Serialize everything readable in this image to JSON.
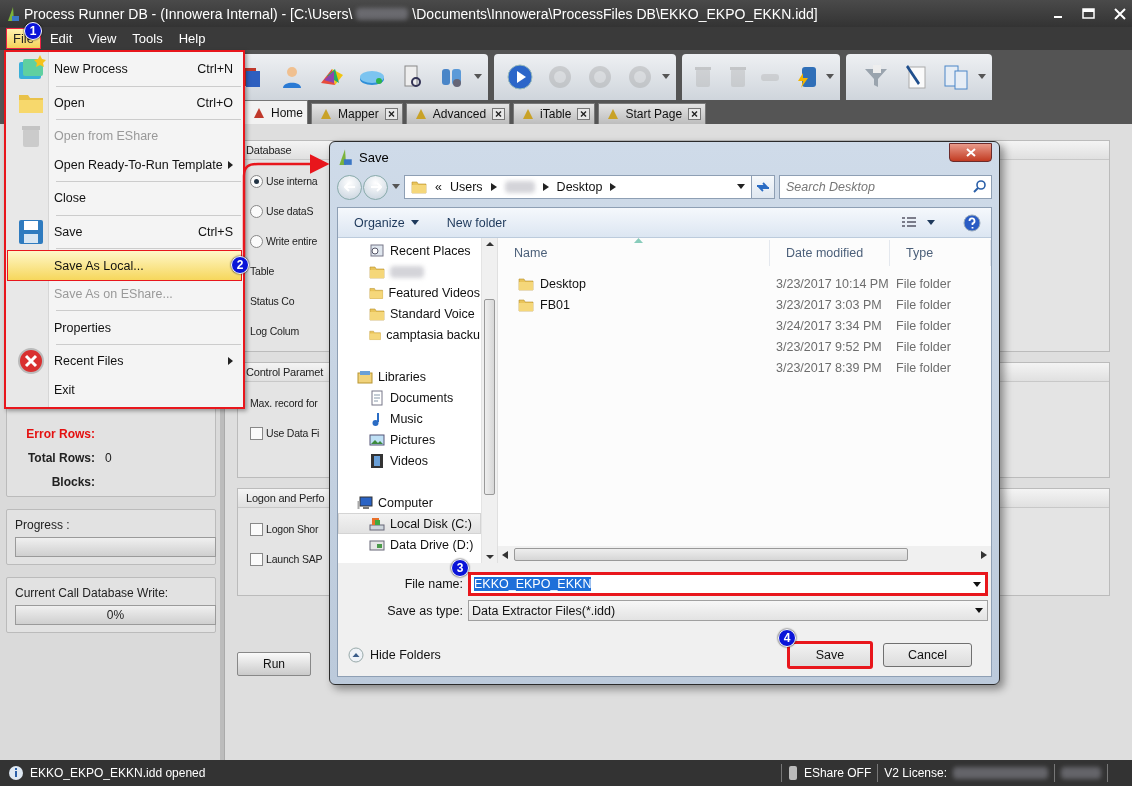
{
  "window": {
    "title_parts": [
      "Process Runner DB - (Innowera Internal) - [C:\\Users\\",
      "\\Documents\\Innowera\\ProcessFiles DB\\EKKO_EKPO_EKKN.idd]"
    ]
  },
  "menu_bar": [
    {
      "label": "File",
      "selected": true
    },
    {
      "label": "Edit",
      "selected": false
    },
    {
      "label": "View",
      "selected": false
    },
    {
      "label": "Tools",
      "selected": false
    },
    {
      "label": "Help",
      "selected": false
    }
  ],
  "toolbar": [
    {
      "items": [
        {
          "disabled": false
        },
        {
          "disabled": false
        },
        {
          "disabled": false
        },
        {
          "disabled": false
        },
        {
          "disabled": false
        },
        {
          "disabled": false
        }
      ]
    },
    {
      "items": [
        {
          "disabled": false
        },
        {
          "disabled": true
        },
        {
          "disabled": true
        },
        {
          "disabled": true
        }
      ]
    },
    {
      "items": [
        {
          "disabled": true
        },
        {
          "disabled": true
        },
        {
          "disabled": true
        },
        {
          "disabled": false
        }
      ]
    },
    {
      "items": [
        {
          "disabled": false
        },
        {
          "disabled": false
        },
        {
          "disabled": false
        }
      ]
    }
  ],
  "tabs": [
    {
      "label": "Home",
      "selected": true,
      "closable": false
    },
    {
      "label": "Mapper",
      "selected": false,
      "closable": true
    },
    {
      "label": "Advanced",
      "selected": false,
      "closable": true
    },
    {
      "label": "iTable",
      "selected": false,
      "closable": true
    },
    {
      "label": "Start Page",
      "selected": false,
      "closable": true
    }
  ],
  "left_panel": {
    "stats": [
      {
        "label": "Error Rows:",
        "error": true
      },
      {
        "label": "Total Rows:",
        "value": "0",
        "error": false
      },
      {
        "label": "Blocks:",
        "error": false
      }
    ],
    "progress": {
      "label": "Progress :",
      "level": 0
    },
    "current_write": {
      "label": "Current Call Database Write:",
      "level": 0,
      "reading": "0%"
    }
  },
  "groups": [
    {
      "title": "Database",
      "rows": [
        {
          "kind": "radio",
          "label": "Use interna",
          "selected": true
        },
        {
          "kind": "radio",
          "label": "Use dataS",
          "selected": false
        },
        {
          "kind": "radio",
          "label": "Write entire",
          "selected": false
        },
        {
          "kind": "label",
          "label": "Table"
        },
        {
          "kind": "label",
          "label": "Status Co"
        },
        {
          "kind": "label",
          "label": "Log Colum"
        }
      ]
    },
    {
      "title": "Control Paramet",
      "rows": [
        {
          "kind": "label",
          "label": "Max. record for"
        },
        {
          "kind": "checkbox",
          "label": "Use Data Fi",
          "checked": false
        }
      ]
    },
    {
      "title": "Logon and Perfo",
      "rows": [
        {
          "kind": "checkbox",
          "label": "Logon Shor",
          "checked": false
        },
        {
          "kind": "checkbox",
          "label": "Launch SAP",
          "checked": false
        }
      ]
    }
  ],
  "run_button": "Run",
  "file_menu": {
    "annotated": true,
    "items": [
      {
        "kind": "item",
        "label": "New Process",
        "shortcut": "Ctrl+N",
        "selected": false,
        "disabled": false,
        "submenu": false
      },
      {
        "kind": "separator"
      },
      {
        "kind": "item",
        "label": "Open",
        "shortcut": "Ctrl+O",
        "selected": false,
        "disabled": false,
        "submenu": false
      },
      {
        "kind": "separator"
      },
      {
        "kind": "item",
        "label": "Open from EShare",
        "selected": false,
        "disabled": true,
        "submenu": false
      },
      {
        "kind": "item",
        "label": "Open Ready-To-Run Template",
        "selected": false,
        "disabled": false,
        "submenu": true
      },
      {
        "kind": "separator"
      },
      {
        "kind": "item",
        "label": "Close",
        "selected": false,
        "disabled": false,
        "submenu": false
      },
      {
        "kind": "separator"
      },
      {
        "kind": "item",
        "label": "Save",
        "shortcut": "Ctrl+S",
        "selected": false,
        "disabled": false,
        "submenu": false
      },
      {
        "kind": "separator"
      },
      {
        "kind": "item",
        "label": "Save As Local...",
        "selected": true,
        "disabled": false,
        "submenu": false
      },
      {
        "kind": "item",
        "label": "Save As on EShare...",
        "selected": false,
        "disabled": true,
        "submenu": false
      },
      {
        "kind": "separator"
      },
      {
        "kind": "item",
        "label": "Properties",
        "selected": false,
        "disabled": false,
        "submenu": false
      },
      {
        "kind": "separator"
      },
      {
        "kind": "item",
        "label": "Recent Files",
        "selected": false,
        "disabled": false,
        "submenu": true
      },
      {
        "kind": "item",
        "label": "Exit",
        "selected": false,
        "disabled": false,
        "submenu": false
      }
    ]
  },
  "save_dialog": {
    "title": "Save",
    "address": {
      "prefix": "«",
      "crumbs": [
        "Users",
        "Desktop"
      ]
    },
    "search": {
      "placeholder": "Search Desktop"
    },
    "commands": [
      "Organize",
      "New folder"
    ],
    "nav": [
      {
        "label": "Recent Places",
        "kind": "recent",
        "selected": false
      },
      {
        "kind": "folder",
        "selected": false,
        "redacted": true
      },
      {
        "label": "Featured Videos",
        "kind": "folder",
        "selected": false
      },
      {
        "label": "Standard Voice",
        "kind": "folder",
        "selected": false
      },
      {
        "label": "camptasia backu",
        "kind": "folder",
        "selected": false
      },
      {
        "label": "Libraries",
        "kind": "libraries",
        "selected": false,
        "children": [
          {
            "label": "Documents",
            "kind": "documents",
            "selected": false
          },
          {
            "label": "Music",
            "kind": "music",
            "selected": false
          },
          {
            "label": "Pictures",
            "kind": "pictures",
            "selected": false
          },
          {
            "label": "Videos",
            "kind": "videos",
            "selected": false
          }
        ]
      },
      {
        "label": "Computer",
        "kind": "computer",
        "selected": false,
        "children": [
          {
            "label": "Local Disk (C:)",
            "kind": "disk",
            "selected": true
          },
          {
            "label": "Data Drive (D:)",
            "kind": "drive",
            "selected": false
          }
        ]
      }
    ],
    "columns": [
      "Name",
      "Date modified",
      "Type"
    ],
    "rows": [
      {
        "name": "Desktop",
        "date": "3/23/2017 10:14 PM",
        "type": "File folder"
      },
      {
        "name": "FB01",
        "date": "3/23/2017 3:03 PM",
        "type": "File folder"
      },
      {
        "date": "3/24/2017 3:34 PM",
        "type": "File folder"
      },
      {
        "date": "3/23/2017 9:52 PM",
        "type": "File folder"
      },
      {
        "date": "3/23/2017 8:39 PM",
        "type": "File folder"
      }
    ],
    "file_name": {
      "label": "File name:",
      "value": "EKKO_EKPO_EKKN",
      "annotated": true
    },
    "file_type": {
      "label": "Save as type:",
      "value": "Data Extractor Files(*.idd)"
    },
    "hide_folders": "Hide Folders",
    "buttons": [
      {
        "label": "Save",
        "annotated": true
      },
      {
        "label": "Cancel",
        "annotated": false
      }
    ]
  },
  "status_bar": {
    "message": "EKKO_EKPO_EKKN.idd opened",
    "eshare": "EShare OFF",
    "license_label": "V2 License:"
  },
  "annotations": [
    "1",
    "2",
    "3",
    "4"
  ]
}
